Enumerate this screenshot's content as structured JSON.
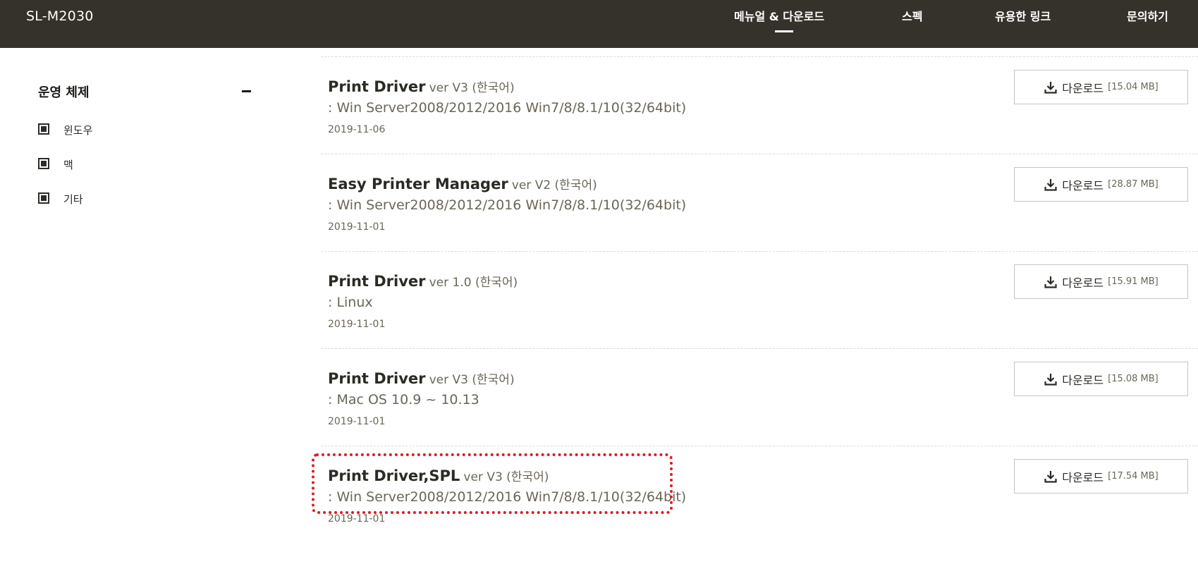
{
  "header": {
    "model": "SL-M2030",
    "nav": [
      {
        "label": "메뉴얼 & 다운로드"
      },
      {
        "label": "스펙"
      },
      {
        "label": "유용한 링크"
      },
      {
        "label": "문의하기"
      }
    ]
  },
  "sidebar": {
    "title": "운영 체제",
    "items": [
      {
        "label": "윈도우"
      },
      {
        "label": "맥"
      },
      {
        "label": "기타"
      }
    ]
  },
  "downloads": [
    {
      "title": "Print Driver",
      "version": "ver V3 (한국어)",
      "os": ": Win Server2008/2012/2016 Win7/8/8.1/10(32/64bit)",
      "date": "2019-11-06",
      "button": "다운로드",
      "size": "[15.04 MB]"
    },
    {
      "title": "Easy Printer Manager",
      "version": "ver V2 (한국어)",
      "os": ": Win Server2008/2012/2016 Win7/8/8.1/10(32/64bit)",
      "date": "2019-11-01",
      "button": "다운로드",
      "size": "[28.87 MB]"
    },
    {
      "title": "Print Driver",
      "version": "ver 1.0 (한국어)",
      "os": ": Linux",
      "date": "2019-11-01",
      "button": "다운로드",
      "size": "[15.91 MB]"
    },
    {
      "title": "Print Driver",
      "version": "ver V3 (한국어)",
      "os": ": Mac OS 10.9 ~ 10.13",
      "date": "2019-11-01",
      "button": "다운로드",
      "size": "[15.08 MB]"
    },
    {
      "title": "Print Driver,SPL",
      "version": "ver V3 (한국어)",
      "os": ": Win Server2008/2012/2016 Win7/8/8.1/10(32/64bit)",
      "date": "2019-11-01",
      "button": "다운로드",
      "size": "[17.54 MB]"
    }
  ],
  "colors": {
    "header_bg": "#35322b",
    "highlight": "#e01a1a"
  }
}
